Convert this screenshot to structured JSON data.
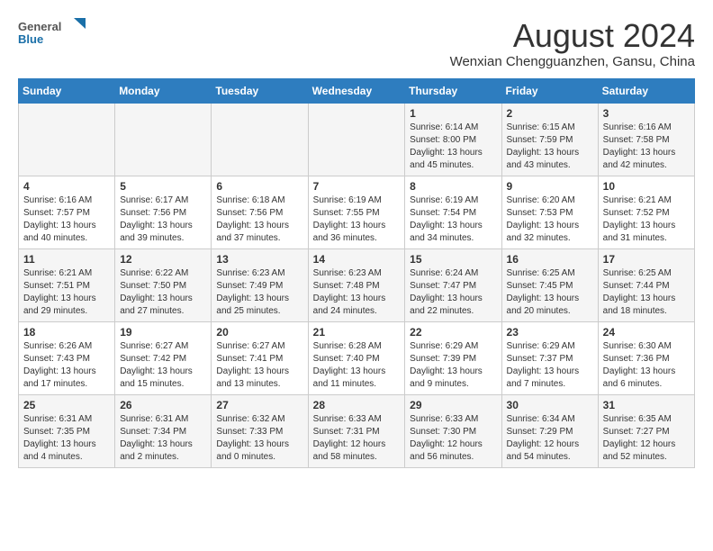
{
  "logo": {
    "line1": "General",
    "line2": "Blue"
  },
  "title": "August 2024",
  "subtitle": "Wenxian Chengguanzhen, Gansu, China",
  "days_of_week": [
    "Sunday",
    "Monday",
    "Tuesday",
    "Wednesday",
    "Thursday",
    "Friday",
    "Saturday"
  ],
  "weeks": [
    [
      {
        "day": "",
        "info": ""
      },
      {
        "day": "",
        "info": ""
      },
      {
        "day": "",
        "info": ""
      },
      {
        "day": "",
        "info": ""
      },
      {
        "day": "1",
        "info": "Sunrise: 6:14 AM\nSunset: 8:00 PM\nDaylight: 13 hours\nand 45 minutes."
      },
      {
        "day": "2",
        "info": "Sunrise: 6:15 AM\nSunset: 7:59 PM\nDaylight: 13 hours\nand 43 minutes."
      },
      {
        "day": "3",
        "info": "Sunrise: 6:16 AM\nSunset: 7:58 PM\nDaylight: 13 hours\nand 42 minutes."
      }
    ],
    [
      {
        "day": "4",
        "info": "Sunrise: 6:16 AM\nSunset: 7:57 PM\nDaylight: 13 hours\nand 40 minutes."
      },
      {
        "day": "5",
        "info": "Sunrise: 6:17 AM\nSunset: 7:56 PM\nDaylight: 13 hours\nand 39 minutes."
      },
      {
        "day": "6",
        "info": "Sunrise: 6:18 AM\nSunset: 7:56 PM\nDaylight: 13 hours\nand 37 minutes."
      },
      {
        "day": "7",
        "info": "Sunrise: 6:19 AM\nSunset: 7:55 PM\nDaylight: 13 hours\nand 36 minutes."
      },
      {
        "day": "8",
        "info": "Sunrise: 6:19 AM\nSunset: 7:54 PM\nDaylight: 13 hours\nand 34 minutes."
      },
      {
        "day": "9",
        "info": "Sunrise: 6:20 AM\nSunset: 7:53 PM\nDaylight: 13 hours\nand 32 minutes."
      },
      {
        "day": "10",
        "info": "Sunrise: 6:21 AM\nSunset: 7:52 PM\nDaylight: 13 hours\nand 31 minutes."
      }
    ],
    [
      {
        "day": "11",
        "info": "Sunrise: 6:21 AM\nSunset: 7:51 PM\nDaylight: 13 hours\nand 29 minutes."
      },
      {
        "day": "12",
        "info": "Sunrise: 6:22 AM\nSunset: 7:50 PM\nDaylight: 13 hours\nand 27 minutes."
      },
      {
        "day": "13",
        "info": "Sunrise: 6:23 AM\nSunset: 7:49 PM\nDaylight: 13 hours\nand 25 minutes."
      },
      {
        "day": "14",
        "info": "Sunrise: 6:23 AM\nSunset: 7:48 PM\nDaylight: 13 hours\nand 24 minutes."
      },
      {
        "day": "15",
        "info": "Sunrise: 6:24 AM\nSunset: 7:47 PM\nDaylight: 13 hours\nand 22 minutes."
      },
      {
        "day": "16",
        "info": "Sunrise: 6:25 AM\nSunset: 7:45 PM\nDaylight: 13 hours\nand 20 minutes."
      },
      {
        "day": "17",
        "info": "Sunrise: 6:25 AM\nSunset: 7:44 PM\nDaylight: 13 hours\nand 18 minutes."
      }
    ],
    [
      {
        "day": "18",
        "info": "Sunrise: 6:26 AM\nSunset: 7:43 PM\nDaylight: 13 hours\nand 17 minutes."
      },
      {
        "day": "19",
        "info": "Sunrise: 6:27 AM\nSunset: 7:42 PM\nDaylight: 13 hours\nand 15 minutes."
      },
      {
        "day": "20",
        "info": "Sunrise: 6:27 AM\nSunset: 7:41 PM\nDaylight: 13 hours\nand 13 minutes."
      },
      {
        "day": "21",
        "info": "Sunrise: 6:28 AM\nSunset: 7:40 PM\nDaylight: 13 hours\nand 11 minutes."
      },
      {
        "day": "22",
        "info": "Sunrise: 6:29 AM\nSunset: 7:39 PM\nDaylight: 13 hours\nand 9 minutes."
      },
      {
        "day": "23",
        "info": "Sunrise: 6:29 AM\nSunset: 7:37 PM\nDaylight: 13 hours\nand 7 minutes."
      },
      {
        "day": "24",
        "info": "Sunrise: 6:30 AM\nSunset: 7:36 PM\nDaylight: 13 hours\nand 6 minutes."
      }
    ],
    [
      {
        "day": "25",
        "info": "Sunrise: 6:31 AM\nSunset: 7:35 PM\nDaylight: 13 hours\nand 4 minutes."
      },
      {
        "day": "26",
        "info": "Sunrise: 6:31 AM\nSunset: 7:34 PM\nDaylight: 13 hours\nand 2 minutes."
      },
      {
        "day": "27",
        "info": "Sunrise: 6:32 AM\nSunset: 7:33 PM\nDaylight: 13 hours\nand 0 minutes."
      },
      {
        "day": "28",
        "info": "Sunrise: 6:33 AM\nSunset: 7:31 PM\nDaylight: 12 hours\nand 58 minutes."
      },
      {
        "day": "29",
        "info": "Sunrise: 6:33 AM\nSunset: 7:30 PM\nDaylight: 12 hours\nand 56 minutes."
      },
      {
        "day": "30",
        "info": "Sunrise: 6:34 AM\nSunset: 7:29 PM\nDaylight: 12 hours\nand 54 minutes."
      },
      {
        "day": "31",
        "info": "Sunrise: 6:35 AM\nSunset: 7:27 PM\nDaylight: 12 hours\nand 52 minutes."
      }
    ]
  ]
}
